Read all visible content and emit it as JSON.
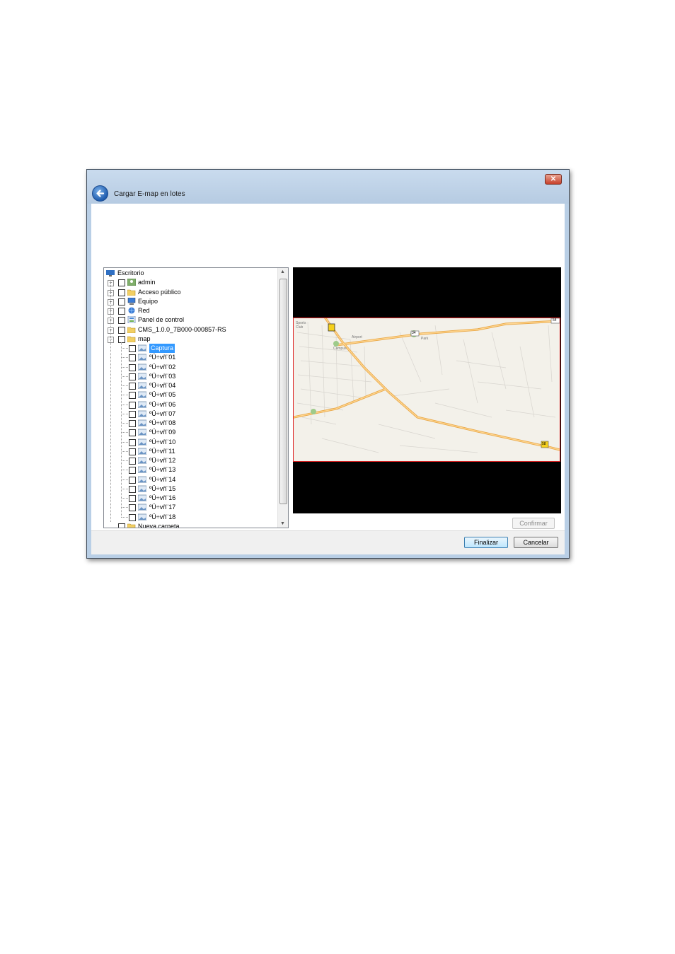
{
  "window": {
    "title": "Cargar E-map en lotes",
    "close_glyph": "✕"
  },
  "tree": {
    "root": {
      "label": "Escritorio",
      "icon": "desktop-icon"
    },
    "items": [
      {
        "label": "admin",
        "icon": "user-folder-icon"
      },
      {
        "label": "Acceso público",
        "icon": "folder-icon"
      },
      {
        "label": "Equipo",
        "icon": "computer-icon"
      },
      {
        "label": "Red",
        "icon": "network-icon"
      },
      {
        "label": "Panel de control",
        "icon": "control-panel-icon"
      },
      {
        "label": "CMS_1.0.0_7B000-000857-RS",
        "icon": "folder-icon"
      },
      {
        "label": "map",
        "icon": "folder-icon"
      }
    ],
    "map_children": [
      "Captura",
      "ºÜ÷vñ¨01",
      "ºÜ÷vñ¨02",
      "ºÜ÷vñ¨03",
      "ºÜ÷vñ¨04",
      "ºÜ÷vñ¨05",
      "ºÜ÷vñ¨06",
      "ºÜ÷vñ¨07",
      "ºÜ÷vñ¨08",
      "ºÜ÷vñ¨09",
      "ºÜ÷vñ¨10",
      "ºÜ÷vñ¨11",
      "ºÜ÷vñ¨12",
      "ºÜ÷vñ¨13",
      "ºÜ÷vñ¨14",
      "ºÜ÷vñ¨15",
      "ºÜ÷vñ¨16",
      "ºÜ÷vñ¨17",
      "ºÜ÷vñ¨18"
    ],
    "selected": "Captura",
    "last": {
      "label": "Nueva carpeta",
      "icon": "folder-icon"
    },
    "expander_collapsed": "+",
    "expander_expanded": "−"
  },
  "preview": {
    "map_labels": {
      "sports_club": "Sports Club",
      "airport": "Airport",
      "campus": "Campus",
      "park": "Park"
    },
    "road_shields": [
      "34",
      "54",
      "58"
    ]
  },
  "buttons": {
    "confirm": "Confirmar",
    "finish": "Finalizar",
    "cancel": "Cancelar"
  },
  "colors": {
    "accent": "#3399ff",
    "window_frame": "#b9cfe6",
    "road": "#f0b65a"
  }
}
